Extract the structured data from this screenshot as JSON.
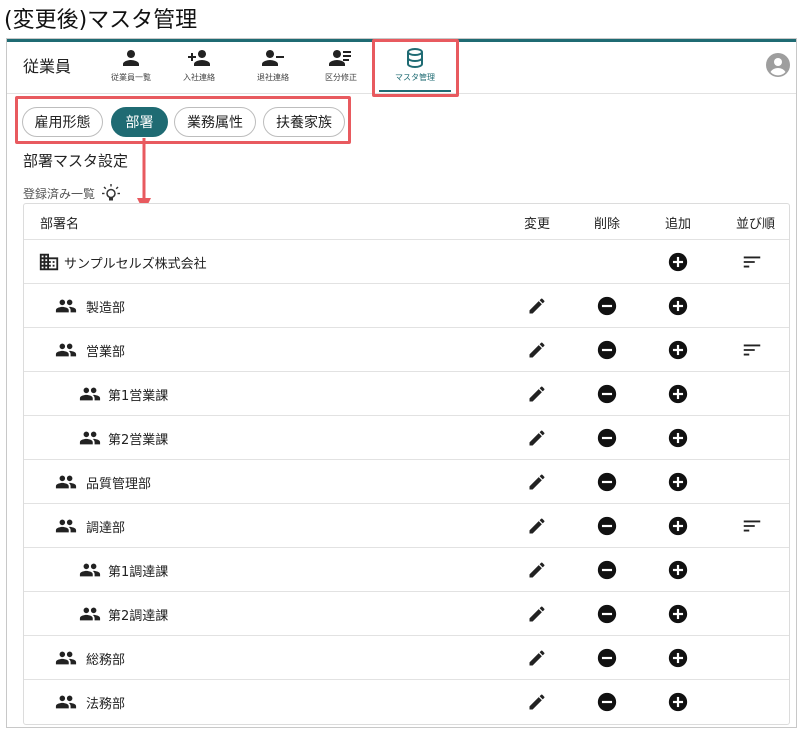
{
  "caption": "(変更後)マスタ管理",
  "app": {
    "title": "従業員"
  },
  "nav": [
    {
      "label": "従業員一覧",
      "icon": "person-icon"
    },
    {
      "label": "入社連絡",
      "icon": "person-add-icon"
    },
    {
      "label": "退社連絡",
      "icon": "person-remove-icon"
    },
    {
      "label": "区分修正",
      "icon": "person-list-icon"
    },
    {
      "label": "マスタ管理",
      "icon": "database-icon",
      "active": true
    }
  ],
  "tabs": [
    {
      "label": "雇用形態"
    },
    {
      "label": "部署",
      "active": true
    },
    {
      "label": "業務属性"
    },
    {
      "label": "扶養家族"
    }
  ],
  "section": {
    "title": "部署マスタ設定",
    "subtitle": "登録済み一覧",
    "tip_icon": "lightbulb-icon"
  },
  "table": {
    "headers": {
      "name": "部署名",
      "edit": "変更",
      "delete": "削除",
      "add": "追加",
      "sort": "並び順"
    },
    "rows": [
      {
        "name": "サンプルセルズ株式会社",
        "level": 0,
        "icon": "building-icon",
        "edit": false,
        "delete": false,
        "add": true,
        "sort": true
      },
      {
        "name": "製造部",
        "level": 1,
        "icon": "group-icon",
        "edit": true,
        "delete": true,
        "add": true,
        "sort": false
      },
      {
        "name": "営業部",
        "level": 1,
        "icon": "group-icon",
        "edit": true,
        "delete": true,
        "add": true,
        "sort": true
      },
      {
        "name": "第1営業課",
        "level": 2,
        "icon": "group-icon",
        "edit": true,
        "delete": true,
        "add": true,
        "sort": false
      },
      {
        "name": "第2営業課",
        "level": 2,
        "icon": "group-icon",
        "edit": true,
        "delete": true,
        "add": true,
        "sort": false
      },
      {
        "name": "品質管理部",
        "level": 1,
        "icon": "group-icon",
        "edit": true,
        "delete": true,
        "add": true,
        "sort": false
      },
      {
        "name": "調達部",
        "level": 1,
        "icon": "group-icon",
        "edit": true,
        "delete": true,
        "add": true,
        "sort": true
      },
      {
        "name": "第1調達課",
        "level": 2,
        "icon": "group-icon",
        "edit": true,
        "delete": true,
        "add": true,
        "sort": false
      },
      {
        "name": "第2調達課",
        "level": 2,
        "icon": "group-icon",
        "edit": true,
        "delete": true,
        "add": true,
        "sort": false
      },
      {
        "name": "総務部",
        "level": 1,
        "icon": "group-icon",
        "edit": true,
        "delete": true,
        "add": true,
        "sort": false
      },
      {
        "name": "法務部",
        "level": 1,
        "icon": "group-icon",
        "edit": true,
        "delete": true,
        "add": true,
        "sort": false
      }
    ]
  },
  "colors": {
    "accent": "#1f6b73",
    "highlight": "#e85a5f"
  }
}
